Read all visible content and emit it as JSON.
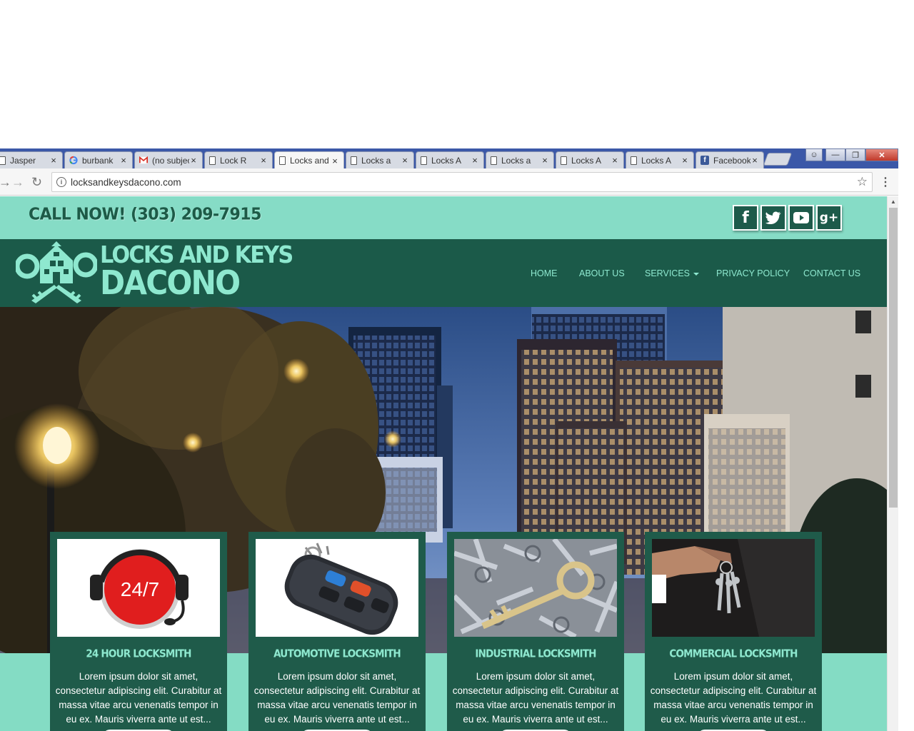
{
  "browser": {
    "tabs": [
      {
        "title": "Jasper",
        "icon": "document-icon"
      },
      {
        "title": "burbank",
        "icon": "google-icon"
      },
      {
        "title": "(no subject)",
        "icon": "gmail-icon"
      },
      {
        "title": "Lock R",
        "icon": "document-icon"
      },
      {
        "title": "Locks and Keys",
        "icon": "document-icon",
        "active": true
      },
      {
        "title": "Locks a",
        "icon": "document-icon"
      },
      {
        "title": "Locks A",
        "icon": "document-icon"
      },
      {
        "title": "Locks a",
        "icon": "document-icon"
      },
      {
        "title": "Locks A",
        "icon": "document-icon"
      },
      {
        "title": "Locks A",
        "icon": "document-icon"
      },
      {
        "title": "Facebook",
        "icon": "facebook-icon"
      }
    ],
    "close_glyph": "×",
    "url": "locksandkeysdacono.com"
  },
  "site": {
    "call_now": "CALL NOW! (303) 209-7915",
    "social": [
      "f",
      "t",
      "▶",
      "g+"
    ],
    "logo_line1": "LOCKS AND KEYS",
    "logo_line2": "DACONO",
    "nav": [
      "HOME",
      "ABOUT US",
      "SERVICES",
      "PRIVACY POLICY",
      "CONTACT US"
    ],
    "accent": "#8ee8cf",
    "header_bg": "#1b5a49",
    "topbar_bg": "#86dcc6"
  },
  "cards": [
    {
      "title": "24 HOUR LOCKSMITH",
      "image_text": "24/7",
      "text": "Lorem ipsum dolor sit amet, consectetur adipiscing elit. Curabitur at massa vitae arcu venenatis tempor in eu ex. Mauris viverra ante ut est..."
    },
    {
      "title": "AUTOMOTIVE LOCKSMITH",
      "image_text": "",
      "text": "Lorem ipsum dolor sit amet, consectetur adipiscing elit. Curabitur at massa vitae arcu venenatis tempor in eu ex. Mauris viverra ante ut est..."
    },
    {
      "title": "INDUSTRIAL LOCKSMITH",
      "image_text": "",
      "text": "Lorem ipsum dolor sit amet, consectetur adipiscing elit. Curabitur at massa vitae arcu venenatis tempor in eu ex. Mauris viverra ante ut est..."
    },
    {
      "title": "COMMERCIAL LOCKSMITH",
      "image_text": "",
      "text": "Lorem ipsum dolor sit amet, consectetur adipiscing elit. Curabitur at massa vitae arcu venenatis tempor in eu ex. Mauris viverra ante ut est..."
    }
  ]
}
